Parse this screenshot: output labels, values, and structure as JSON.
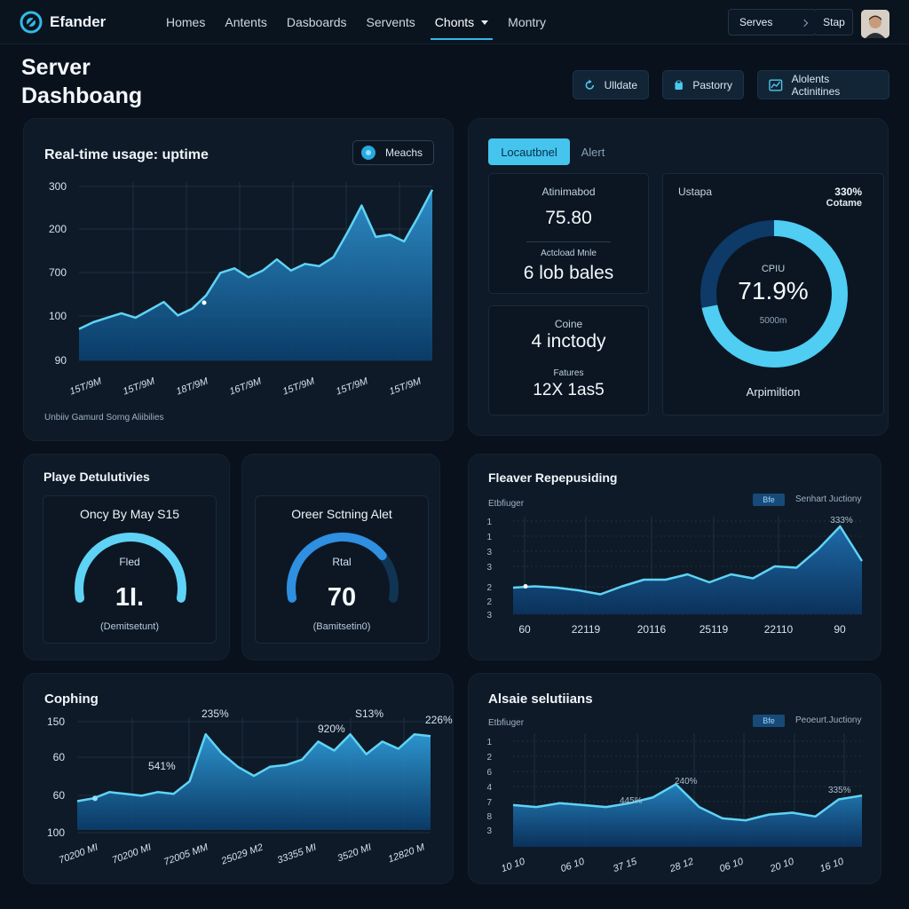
{
  "app": {
    "name": "Efander"
  },
  "nav": {
    "items": [
      "Homes",
      "Antents",
      "Dasboards",
      "Servents",
      "Chonts",
      "Montry"
    ],
    "active_index": 4
  },
  "top_controls": {
    "select_value": "Serves",
    "stop_label": "Stap"
  },
  "page": {
    "title_line1": "Server",
    "title_line2": "Dashboang"
  },
  "header_buttons": [
    {
      "label": "Ulldate",
      "icon": "refresh-icon"
    },
    {
      "label": "Pastorry",
      "icon": "clipboard-icon"
    },
    {
      "label": "Alolents Actinitines",
      "icon": "chart-icon"
    }
  ],
  "colors": {
    "accent": "#33b9e6",
    "accent_dark": "#1a6ea8",
    "panel": "#0e1a27",
    "background": "#08111c"
  },
  "usage_panel": {
    "title": "Real-time usage: uptime",
    "button_label": "Meachs",
    "footer": "Unbiiv Gamurd Sorng Aliibilies",
    "chart_data": {
      "type": "area",
      "y_tick_labels": [
        "300",
        "200",
        "700",
        "100",
        "90"
      ],
      "x_tick_labels": [
        "15T/9M",
        "15T/9M",
        "18T/9M",
        "16T/9M",
        "15T/9M",
        "15T/9M",
        "15T/9M"
      ],
      "values": [
        0.28,
        0.34,
        0.38,
        0.42,
        0.38,
        0.45,
        0.52,
        0.4,
        0.46,
        0.58,
        0.78,
        0.82,
        0.74,
        0.8,
        0.9,
        0.8,
        0.86,
        0.84,
        0.92,
        1.14,
        1.38,
        1.1,
        1.12,
        1.06,
        1.28,
        1.52
      ],
      "y_scale": "relative (0 = bottom of plot, 1.55 = top)",
      "grid": true
    }
  },
  "summary_panel": {
    "tabs": [
      "Locautbnel",
      "Alert"
    ],
    "active_tab": 0,
    "stats": [
      {
        "label": "Atinimabod",
        "value": "75.80"
      },
      {
        "label": "Actcload Mnle",
        "value": "6 lob bales"
      },
      {
        "label": "Coine",
        "value": "4 inctody"
      },
      {
        "label": "Fatures",
        "value": "12X 1as5"
      }
    ],
    "donut": {
      "title": "Ustapa",
      "corner_value": "330%",
      "corner_label": "Cotame",
      "center_label": "CPIU",
      "center_value": "71.9%",
      "center_sub": "5000m",
      "footer": "Arpimiltion",
      "percent": 71.9
    }
  },
  "gauges_panel": {
    "title": "Playe Detulutivies",
    "gauges": [
      {
        "title": "Oncy By May S15",
        "label": "Fled",
        "value": "1I.",
        "sub": "(Demitsetunt)",
        "fraction": 1.0
      },
      {
        "title": "Oreer Sctning Alet",
        "label": "Rtal",
        "value": "70",
        "sub": "(Bamitsetin0)",
        "fraction": 0.75
      }
    ]
  },
  "repeat_panel": {
    "title": "Fleaver Repepusiding",
    "subtitle": "Etbfiuger",
    "legend_chip": "Bfe",
    "legend_text": "Senhart Juctiony",
    "peak_label": "333%",
    "chart_data": {
      "type": "area",
      "y_tick_labels": [
        "1",
        "1",
        "3",
        "3",
        "2",
        "2",
        "3"
      ],
      "x_tick_labels": [
        "60",
        "22119",
        "20116",
        "25119",
        "22110",
        "90"
      ],
      "values": [
        0.4,
        0.42,
        0.4,
        0.36,
        0.3,
        0.42,
        0.52,
        0.52,
        0.6,
        0.48,
        0.6,
        0.54,
        0.72,
        0.7,
        0.98,
        1.32,
        0.8
      ]
    }
  },
  "cophing_panel": {
    "title": "Cophing",
    "annotations": [
      "235%",
      "541%",
      "920%",
      "S13%",
      "226%"
    ],
    "chart_data": {
      "type": "area",
      "y_tick_labels": [
        "150",
        "60",
        "60",
        "100"
      ],
      "x_tick_labels": [
        "70200 MI",
        "70200 MI",
        "72005 MM",
        "25029 M2",
        "33355 MI",
        "3520 MI",
        "12820 M"
      ],
      "values": [
        0.32,
        0.35,
        0.42,
        0.4,
        0.38,
        0.42,
        0.4,
        0.54,
        1.06,
        0.85,
        0.7,
        0.6,
        0.7,
        0.72,
        0.78,
        0.98,
        0.88,
        1.06,
        0.84,
        0.98,
        0.9,
        1.06,
        1.04
      ]
    }
  },
  "solutions_panel": {
    "title": "Alsaie selutiians",
    "subtitle": "Etbfiuger",
    "legend_chip": "Bfe",
    "legend_text": "Peoeurt.Juctiony",
    "annotations": [
      "445%",
      "240%",
      "335%"
    ],
    "chart_data": {
      "type": "area",
      "y_tick_labels": [
        "1",
        "2",
        "6",
        "4",
        "7",
        "8",
        "3"
      ],
      "x_tick_labels": [
        "10 10",
        "06 10",
        "37 15",
        "28 12",
        "06 10",
        "20 10",
        "16 10"
      ],
      "values": [
        0.44,
        0.42,
        0.46,
        0.44,
        0.42,
        0.46,
        0.52,
        0.66,
        0.42,
        0.3,
        0.28,
        0.34,
        0.36,
        0.32,
        0.5,
        0.54
      ]
    }
  }
}
